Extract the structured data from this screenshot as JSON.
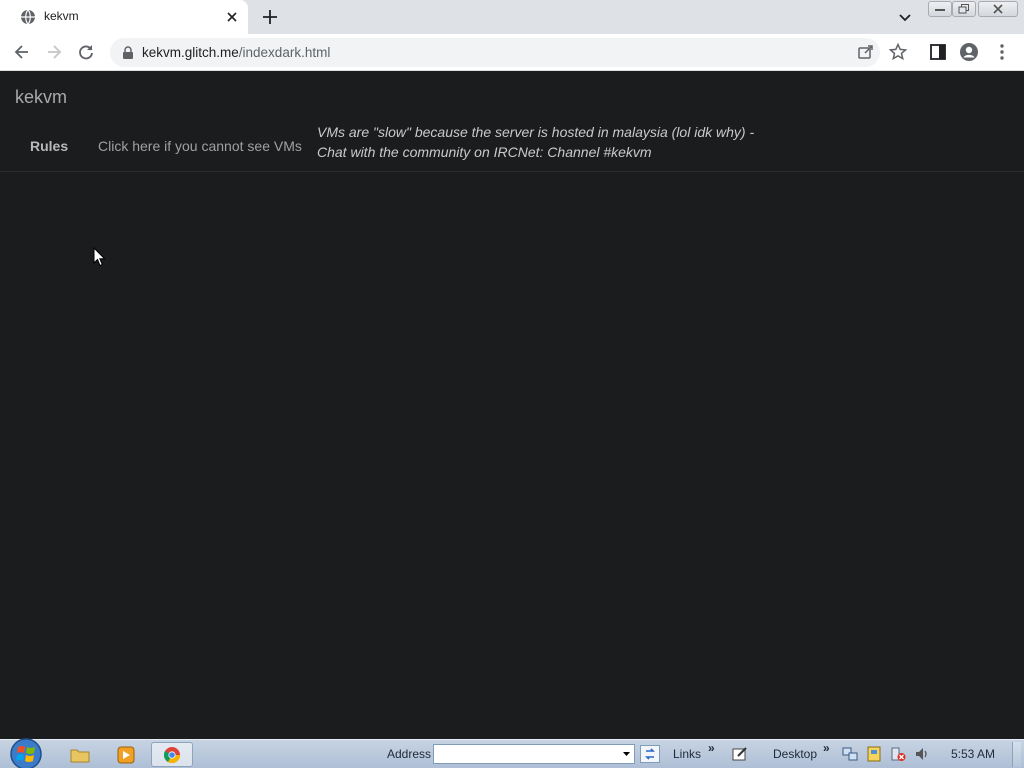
{
  "browser": {
    "tab_title": "kekvm",
    "url_host": "kekvm.glitch.me",
    "url_path": "/indexdark.html"
  },
  "page": {
    "brand": "kekvm",
    "nav": {
      "rules": "Rules",
      "cannot_see_vms": "Click here if you cannot see VMs"
    },
    "notice_line1": "VMs are \"slow\" because the server is hosted in malaysia (lol idk why) -",
    "notice_line2": "Chat with the community on IRCNet: Channel #kekvm"
  },
  "taskbar": {
    "address_label": "Address",
    "address_value": "",
    "links_label": "Links",
    "desktop_label": "Desktop",
    "chevron": "»",
    "clock": "5:53 AM"
  },
  "colors": {
    "page_bg": "#1b1c1e",
    "brand_text": "#a8a9ab",
    "nav_text": "#b8b9bb"
  }
}
